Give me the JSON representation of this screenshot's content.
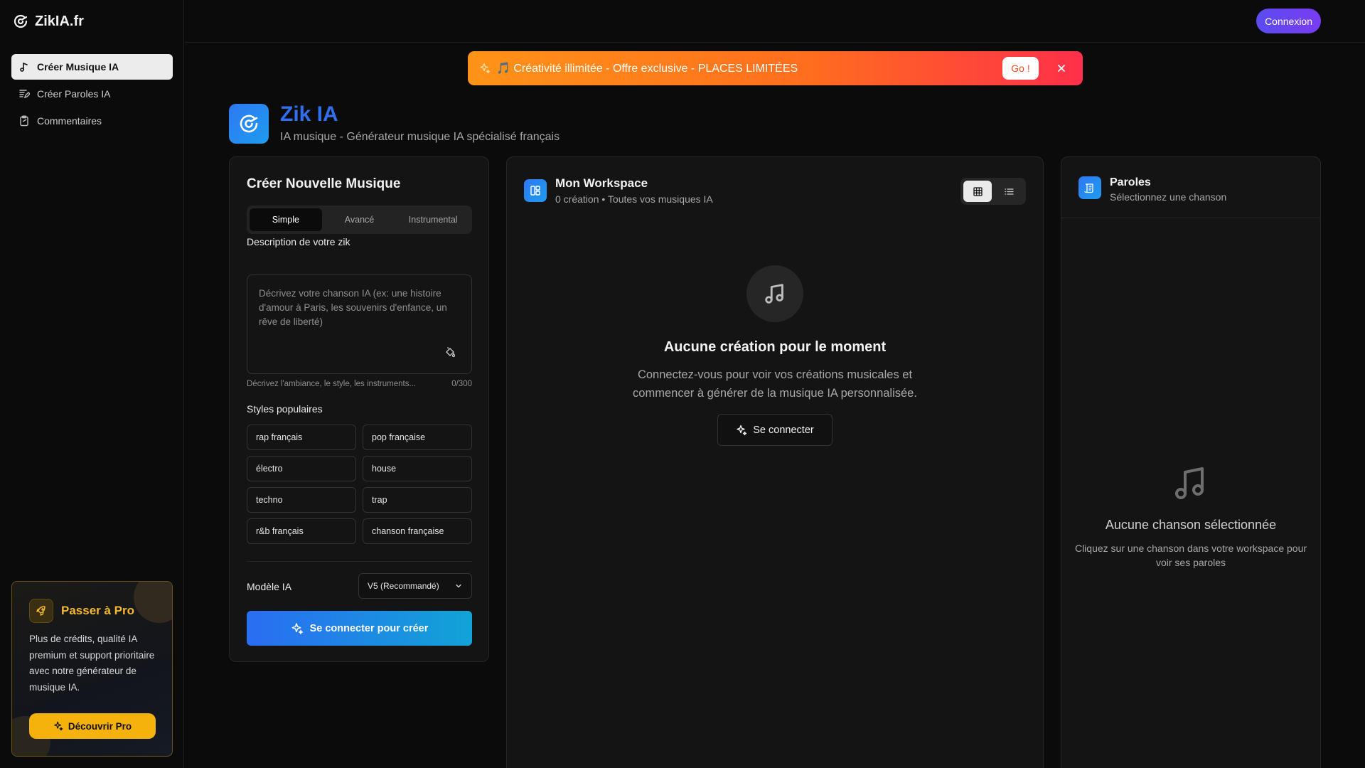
{
  "brand": {
    "name": "ZikIA.fr"
  },
  "sidebar": {
    "items": [
      {
        "label": "Créer Musique IA",
        "icon": "music-note-icon",
        "active": true
      },
      {
        "label": "Créer Paroles IA",
        "icon": "edit-lyrics-icon",
        "active": false
      },
      {
        "label": "Commentaires",
        "icon": "clipboard-icon",
        "active": false
      }
    ],
    "pro": {
      "title": "Passer à Pro",
      "text": "Plus de crédits, qualité IA premium et support prioritaire avec notre générateur de musique IA.",
      "button": "Découvrir Pro",
      "accent": "#f5b10c"
    }
  },
  "header": {
    "login_label": "Connexion"
  },
  "promo": {
    "text": "🎵 Créativité illimitée - Offre exclusive - PLACES LIMITÉES",
    "go_label": "Go !"
  },
  "app": {
    "title": "Zik IA",
    "subtitle": "IA musique - Générateur musique IA spécialisé français",
    "accent": "#2f6ff0"
  },
  "create": {
    "title": "Créer Nouvelle Musique",
    "tabs": [
      "Simple",
      "Avancé",
      "Instrumental"
    ],
    "active_tab": "Simple",
    "description_label": "Description de votre zik",
    "description_placeholder": "Décrivez votre chanson IA (ex: une histoire d'amour à Paris, les souvenirs d'enfance, un rêve de liberté)",
    "description_value": "",
    "hint": "Décrivez l'ambiance, le style, les instruments...",
    "char_count": "0/300",
    "styles_label": "Styles populaires",
    "styles": [
      "rap français",
      "pop française",
      "électro",
      "house",
      "techno",
      "trap",
      "r&b français",
      "chanson française"
    ],
    "model_label": "Modèle IA",
    "model_value": "V5 (Recommandé)",
    "submit_label": "Se connecter pour créer"
  },
  "workspace": {
    "title": "Mon Workspace",
    "subtitle": "0 création • Toutes vos musiques IA",
    "view_mode": "grid",
    "empty_title": "Aucune création pour le moment",
    "empty_text": "Connectez-vous pour voir vos créations musicales et commencer à générer de la musique IA personnalisée.",
    "signin_label": "Se connecter"
  },
  "lyrics": {
    "title": "Paroles",
    "subtitle": "Sélectionnez une chanson",
    "empty_title": "Aucune chanson sélectionnée",
    "empty_text": "Cliquez sur une chanson dans votre workspace pour voir ses paroles"
  }
}
